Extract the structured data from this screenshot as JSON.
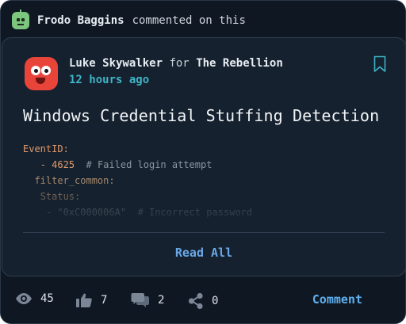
{
  "activity": {
    "actor": "Frodo Baggins",
    "verb": "commented on this",
    "icon": "robot-avatar-icon"
  },
  "post": {
    "author": "Luke Skywalker",
    "for_label": "for",
    "org": "The Rebellion",
    "time": "12 hours ago",
    "title": "Windows Credential Stuffing Detection",
    "code": {
      "line1_key": "EventID:",
      "line2_dash": "- ",
      "line2_num": "4625",
      "line2_comment": "# Failed login attempt",
      "line3_key": "filter_common:",
      "line4_key": "Status:",
      "line5_dash": "- ",
      "line5_str": "\"0xC000006A\"",
      "line5_comment": "# Incorrect password"
    },
    "read_all": "Read All",
    "bookmark_icon": "bookmark-icon"
  },
  "stats": {
    "views": "45",
    "likes": "7",
    "comments": "2",
    "shares": "0",
    "comment_button": "Comment"
  },
  "colors": {
    "background": "#0f1722",
    "card": "#15212e",
    "accent_blue": "#6aa8e8",
    "time_teal": "#3fb4c9",
    "code_key": "#e39a6b"
  }
}
